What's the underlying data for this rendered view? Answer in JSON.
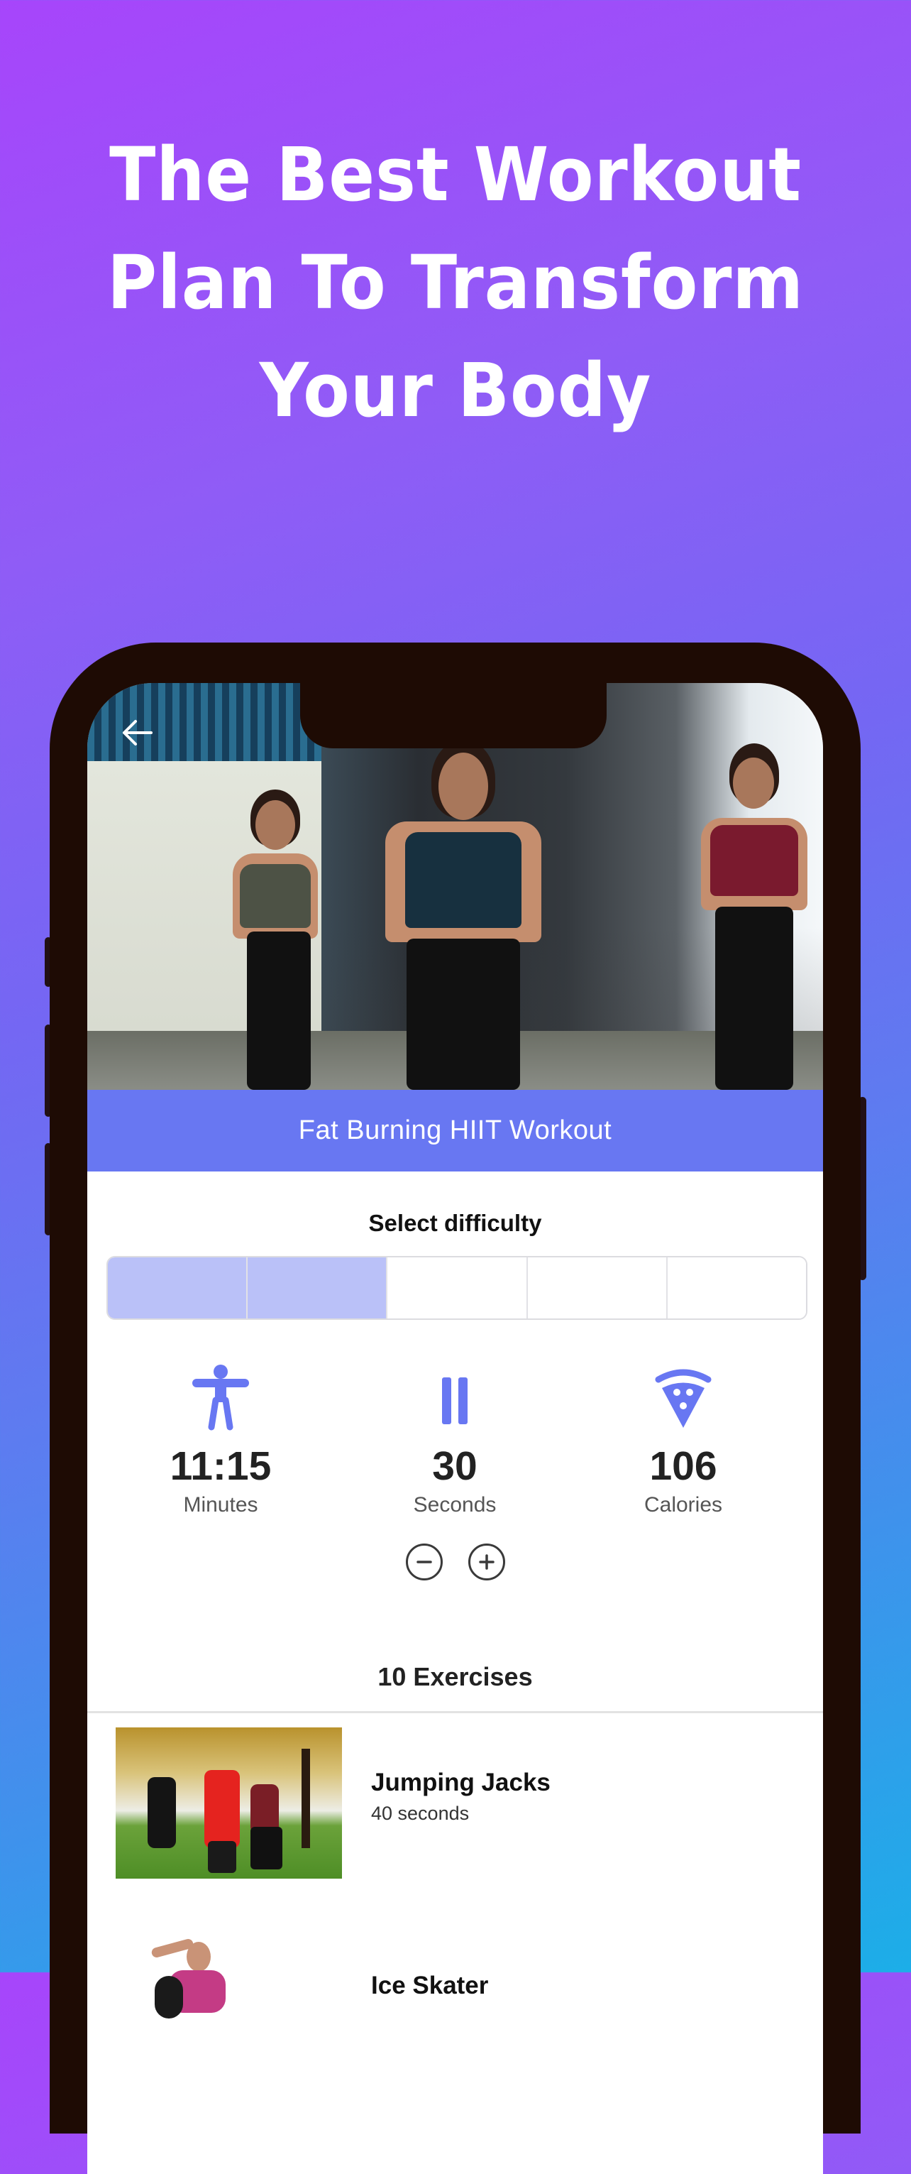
{
  "headline": {
    "lines": [
      "The Best Workout",
      "Plan To Transform",
      "Your Body"
    ]
  },
  "colors": {
    "accent": "#6877F2",
    "difficulty_selected": "#BAC1F8",
    "phone_frame": "#1E0B04",
    "background_start": "#A745FB",
    "background_end": "#1CAEE8"
  },
  "app": {
    "back_icon": "arrow-left-icon",
    "workout_title": "Fat Burning HIIT Workout",
    "difficulty": {
      "label": "Select difficulty",
      "levels_total": 5,
      "levels_selected": 2
    },
    "stats": [
      {
        "icon": "body-icon",
        "value": "11:15",
        "label": "Minutes"
      },
      {
        "icon": "pause-icon",
        "value": "30",
        "label": "Seconds"
      },
      {
        "icon": "pizza-icon",
        "value": "106",
        "label": "Calories"
      }
    ],
    "adjust": {
      "decrease_icon": "minus-circle-icon",
      "increase_icon": "plus-circle-icon"
    },
    "exercises": {
      "header": "10 Exercises",
      "items": [
        {
          "name": "Jumping Jacks",
          "duration": "40 seconds"
        },
        {
          "name": "Ice Skater",
          "duration": ""
        }
      ]
    }
  }
}
